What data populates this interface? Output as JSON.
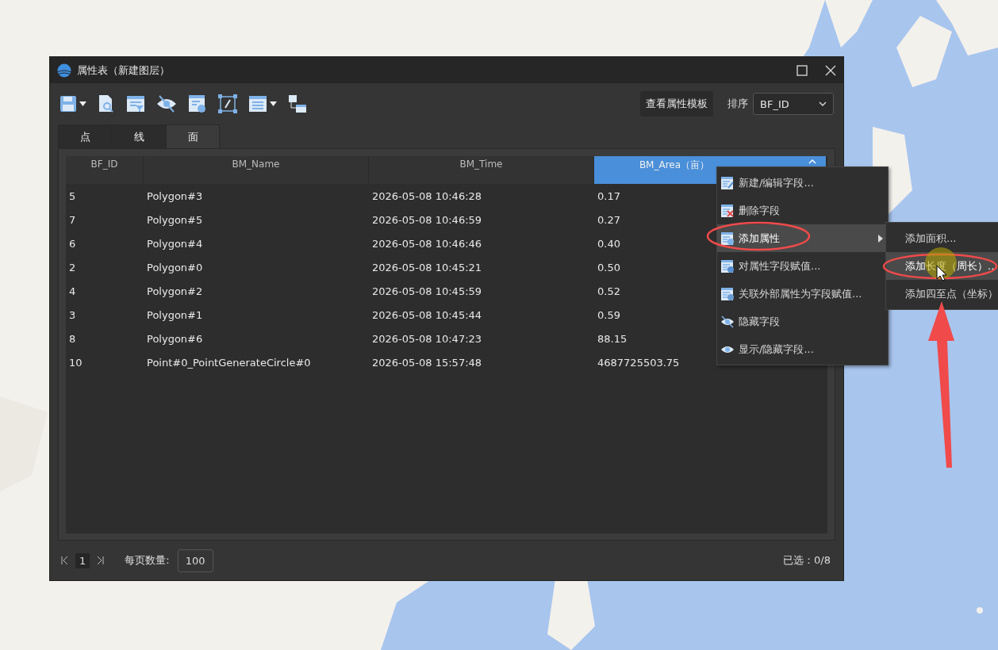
{
  "window": {
    "title": "属性表（新建图层）"
  },
  "toolbar": {
    "template_button": "查看属性模板",
    "sort_label": "排序",
    "sort_value": "BF_ID"
  },
  "tabs": [
    {
      "label": "点",
      "selected": false
    },
    {
      "label": "线",
      "selected": false
    },
    {
      "label": "面",
      "selected": true
    }
  ],
  "table": {
    "columns": [
      {
        "label": "BF_ID",
        "selected": false
      },
      {
        "label": "BM_Name",
        "selected": false
      },
      {
        "label": "BM_Time",
        "selected": false
      },
      {
        "label": "BM_Area（亩）",
        "selected": true
      }
    ],
    "rows": [
      [
        "5",
        "Polygon#3",
        "2026-05-08 10:46:28",
        "0.17"
      ],
      [
        "7",
        "Polygon#5",
        "2026-05-08 10:46:59",
        "0.27"
      ],
      [
        "6",
        "Polygon#4",
        "2026-05-08 10:46:46",
        "0.40"
      ],
      [
        "2",
        "Polygon#0",
        "2026-05-08 10:45:21",
        "0.50"
      ],
      [
        "4",
        "Polygon#2",
        "2026-05-08 10:45:59",
        "0.52"
      ],
      [
        "3",
        "Polygon#1",
        "2026-05-08 10:45:44",
        "0.59"
      ],
      [
        "8",
        "Polygon#6",
        "2026-05-08 10:47:23",
        "88.15"
      ],
      [
        "10",
        "Point#0_PointGenerateCircle#0",
        "2026-05-08 15:57:48",
        "4687725503.75"
      ]
    ]
  },
  "footer": {
    "page": "1",
    "page_size_label": "每页数量:",
    "page_size": "100",
    "selected_count": "已选：0/8"
  },
  "context_menu": {
    "items": [
      {
        "kind": "edit",
        "label": "新建/编辑字段...",
        "selected": false,
        "submenu": false
      },
      {
        "kind": "delete",
        "label": "删除字段",
        "selected": false,
        "submenu": false
      },
      {
        "kind": "add",
        "label": "添加属性",
        "selected": true,
        "submenu": true
      },
      {
        "kind": "assign",
        "label": "对属性字段赋值...",
        "selected": false,
        "submenu": false
      },
      {
        "kind": "link",
        "label": "关联外部属性为字段赋值...",
        "selected": false,
        "submenu": false
      },
      {
        "kind": "hide",
        "label": "隐藏字段",
        "selected": false,
        "submenu": false
      },
      {
        "kind": "show",
        "label": "显示/隐藏字段...",
        "selected": false,
        "submenu": false
      }
    ]
  },
  "submenu": {
    "items": [
      {
        "label": "添加面积...",
        "selected": false
      },
      {
        "label": "添加长度（周长）..",
        "selected": true
      },
      {
        "label": "添加四至点（坐标）",
        "selected": false
      }
    ]
  }
}
